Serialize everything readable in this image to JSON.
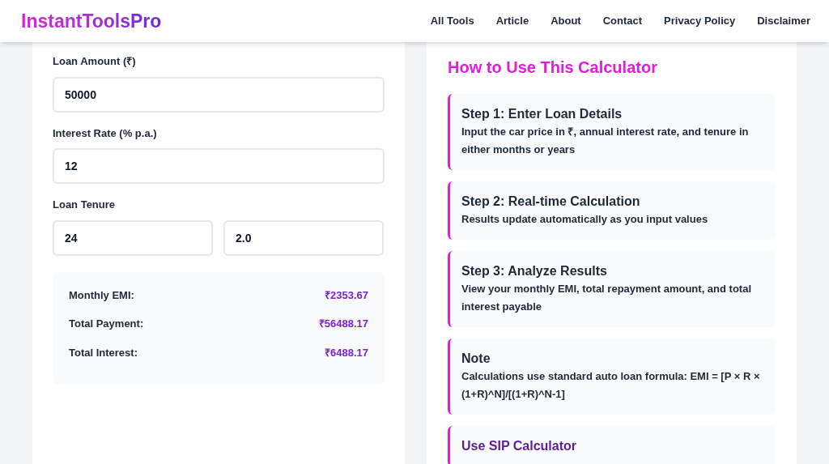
{
  "header": {
    "logo": "InstantToolsPro",
    "nav": [
      "All Tools",
      "Article",
      "About",
      "Contact",
      "Privacy Policy",
      "Disclaimer"
    ]
  },
  "calculator": {
    "fields": [
      {
        "label": "Loan Amount (₹)",
        "value": "50000"
      },
      {
        "label": "Interest Rate (% p.a.)",
        "value": "12"
      }
    ],
    "tenure": {
      "label": "Loan Tenure",
      "months": "24",
      "years": "2.0"
    },
    "results": [
      {
        "label": "Monthly EMI:",
        "value": "₹2353.67"
      },
      {
        "label": "Total Payment:",
        "value": "₹56488.17"
      },
      {
        "label": "Total Interest:",
        "value": "₹6488.17"
      }
    ]
  },
  "guide": {
    "title": "How to Use This Calculator",
    "items": [
      {
        "kind": "step",
        "title": "Step 1: Enter Loan Details",
        "text": "Input the car price in ₹, annual interest rate, and tenure in either months or years"
      },
      {
        "kind": "step",
        "title": "Step 2: Real-time Calculation",
        "text": "Results update automatically as you input values"
      },
      {
        "kind": "step",
        "title": "Step 3: Analyze Results",
        "text": "View your monthly EMI, total repayment amount, and total interest payable"
      },
      {
        "kind": "step",
        "title": "Note",
        "text": "Calculations use standard auto loan formula: EMI = [P × R × (1+R)^N]/[(1+R)^N-1]"
      },
      {
        "kind": "link",
        "title": "Use SIP Calculator"
      }
    ]
  }
}
